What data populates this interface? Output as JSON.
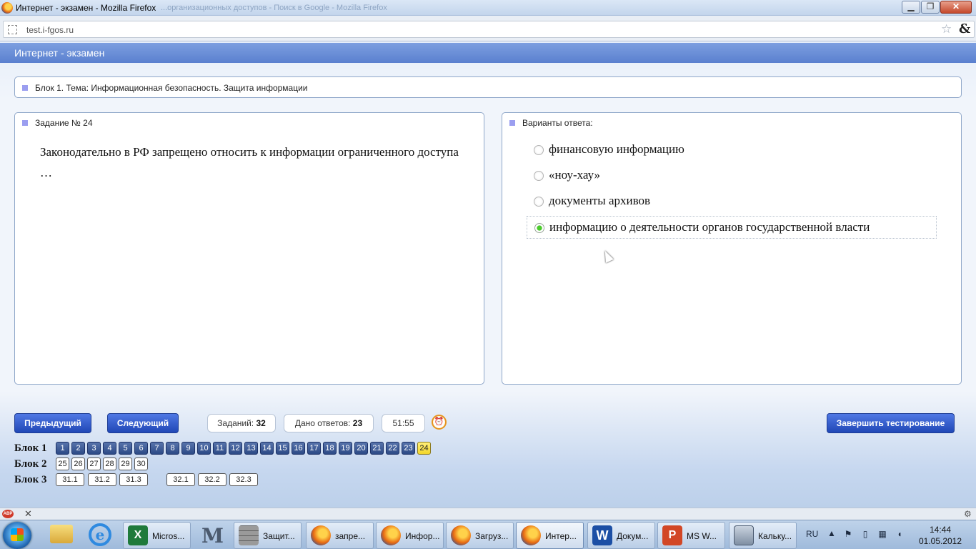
{
  "window": {
    "title": "Интернет - экзамен - Mozilla Firefox",
    "ghost_title": "...организационных доступов - Поиск в Google - Mozilla Firefox",
    "min": "▁",
    "max": "❐",
    "close": "✕"
  },
  "browser": {
    "url": "test.i-fgos.ru",
    "star": "☆",
    "addon": "&"
  },
  "app": {
    "header": "Интернет - экзамен"
  },
  "block_title": "Блок 1. Тема: Информационная безопасность. Защита информации",
  "question": {
    "label": "Задание № 24",
    "text": "Законодательно в РФ запрещено относить к информации ограниченного доступа …"
  },
  "answers": {
    "label": "Варианты ответа:",
    "options": [
      {
        "text": "финансовую информацию",
        "selected": false
      },
      {
        "text": "«ноу-хау»",
        "selected": false
      },
      {
        "text": "документы архивов",
        "selected": false
      },
      {
        "text": "информацию о деятельности органов государственной власти",
        "selected": true
      }
    ]
  },
  "controls": {
    "prev": "Предыдущий",
    "next": "Следующий",
    "finish": "Завершить тестирование",
    "tasks_label": "Заданий:",
    "tasks_value": "32",
    "answered_label": "Дано ответов:",
    "answered_value": "23",
    "timer": "51:55",
    "timer_icon": "alarm-clock-icon"
  },
  "navigator": {
    "blocks": [
      {
        "label": "Блок 1",
        "items": [
          "1",
          "2",
          "3",
          "4",
          "5",
          "6",
          "7",
          "8",
          "9",
          "10",
          "11",
          "12",
          "13",
          "14",
          "15",
          "16",
          "17",
          "18",
          "19",
          "20",
          "21",
          "22",
          "23",
          "24"
        ],
        "current": "24",
        "answered_upto": 23
      },
      {
        "label": "Блок 2",
        "items": [
          "25",
          "26",
          "27",
          "28",
          "29",
          "30"
        ]
      },
      {
        "label": "Блок 3",
        "items": [
          "31.1",
          "31.2",
          "31.3",
          "32.1",
          "32.2",
          "32.3"
        ]
      }
    ]
  },
  "addon_bar": {
    "abp": "ABP",
    "close": "✕",
    "gear": "⚙"
  },
  "taskbar": {
    "items": [
      {
        "label": "Micros...",
        "icon": "excel-icon"
      },
      {
        "label": "Защит...",
        "icon": "wall-icon"
      },
      {
        "label": "запре...",
        "icon": "firefox-icon"
      },
      {
        "label": "Инфор...",
        "icon": "firefox-icon"
      },
      {
        "label": "Загруз...",
        "icon": "firefox-icon"
      },
      {
        "label": "Интер...",
        "icon": "firefox-icon",
        "active": true
      },
      {
        "label": "Докум...",
        "icon": "word-icon"
      },
      {
        "label": "MS W...",
        "icon": "powerpoint-icon"
      },
      {
        "label": "Кальку...",
        "icon": "calculator-icon"
      }
    ],
    "lang": "RU",
    "time": "14:44",
    "date": "01.05.2012"
  }
}
